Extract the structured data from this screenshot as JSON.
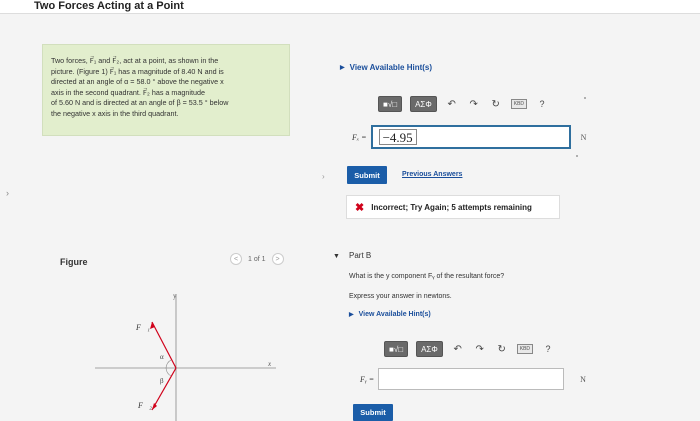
{
  "header": {
    "title": "Two Forces Acting at a Point"
  },
  "problem": {
    "text": [
      "Two forces, F⃗₁ and F⃗₂, act at a point, as shown in the",
      "picture. (Figure 1) F⃗₁ has a magnitude of 8.40 N and is",
      "directed at an angle of α = 58.0 ° above the negative x",
      "axis in the second quadrant. F⃗₂ has a magnitude",
      "of 5.60 N and is directed at an angle of β = 53.5 ° below",
      "the negative x axis in the third quadrant."
    ]
  },
  "figure": {
    "label": "Figure",
    "pager": "1 of 1",
    "prev_glyph": "<",
    "next_glyph": ">",
    "f1_label": "F⃗₁",
    "f2_label": "F⃗₂",
    "alpha": "α",
    "beta": "β",
    "y_axis": "y",
    "x_axis": "x"
  },
  "part_a": {
    "hint": "View Available Hint(s)",
    "toolbar": {
      "template": "■√□",
      "greek": "AΣΦ",
      "kbd": "KBD",
      "help": "?"
    },
    "label": "Fₓ =",
    "value": "−4.95",
    "unit": "N",
    "submit": "Submit",
    "previous": "Previous Answers",
    "feedback": "Incorrect; Try Again; 5 attempts remaining"
  },
  "part_b": {
    "title": "Part B",
    "question": "What is the y component Fᵧ of the resultant force?",
    "instructions": "Express your answer in newtons.",
    "hint": "View Available Hint(s)",
    "toolbar": {
      "template": "■√□",
      "greek": "AΣΦ",
      "kbd": "KBD",
      "help": "?"
    },
    "label": "Fᵧ =",
    "value": "",
    "unit": "N",
    "submit": "Submit"
  },
  "nav": {
    "left": "›",
    "mid": "›",
    "collapse": "▼"
  },
  "colors": {
    "accent": "#1b5da8",
    "problem_bg": "#e2eecd",
    "vector": "#d0021b",
    "error": "#d0021b"
  },
  "icons": [
    "undo-icon",
    "redo-icon",
    "reset-icon",
    "keyboard-icon",
    "help-icon",
    "incorrect-x-icon"
  ]
}
